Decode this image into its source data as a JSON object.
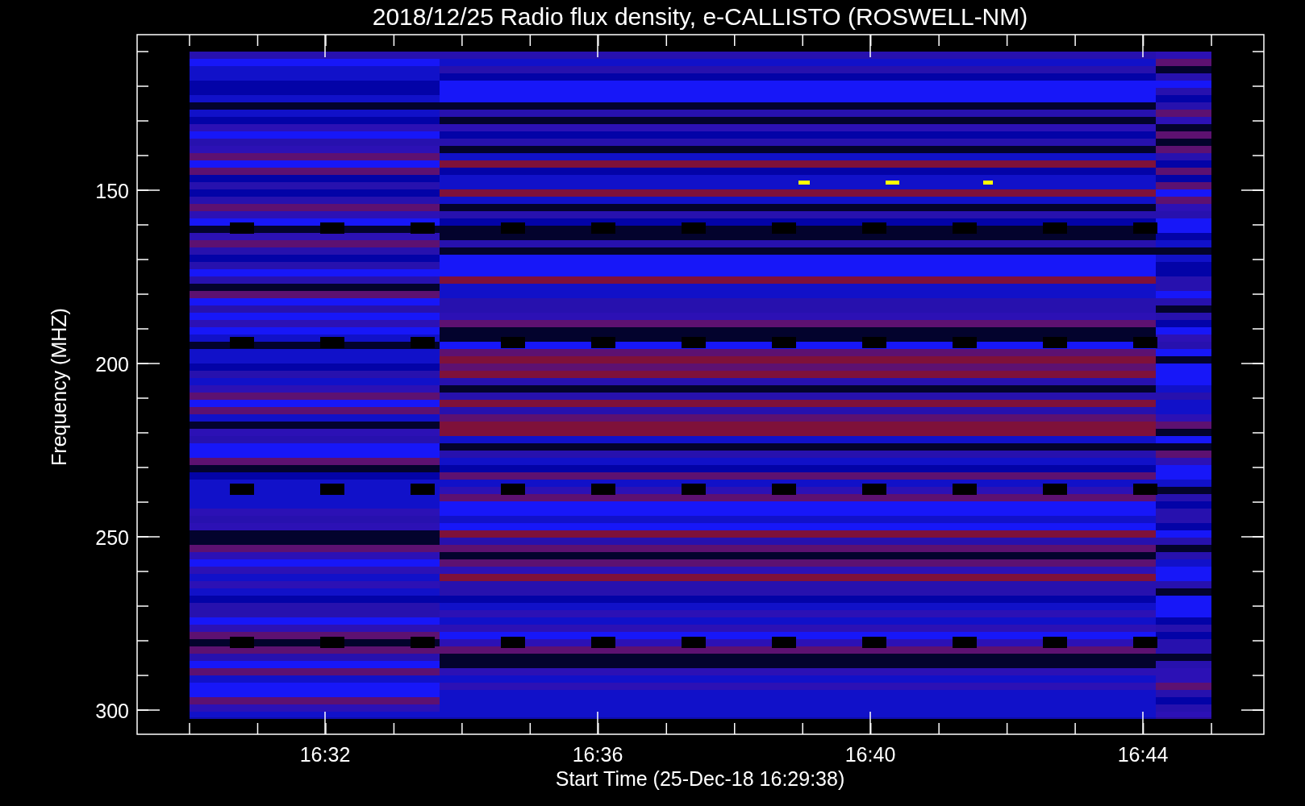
{
  "title": "2018/12/25  Radio flux density, e-CALLISTO (ROSWELL-NM)",
  "y_axis": {
    "label": "Frequency (MHZ)",
    "ticks": [
      "150",
      "200",
      "250",
      "300"
    ]
  },
  "x_axis": {
    "label": "Start Time (25-Dec-18 16:29:38)",
    "ticks": [
      "16:32",
      "16:36",
      "16:40",
      "16:44"
    ]
  }
}
